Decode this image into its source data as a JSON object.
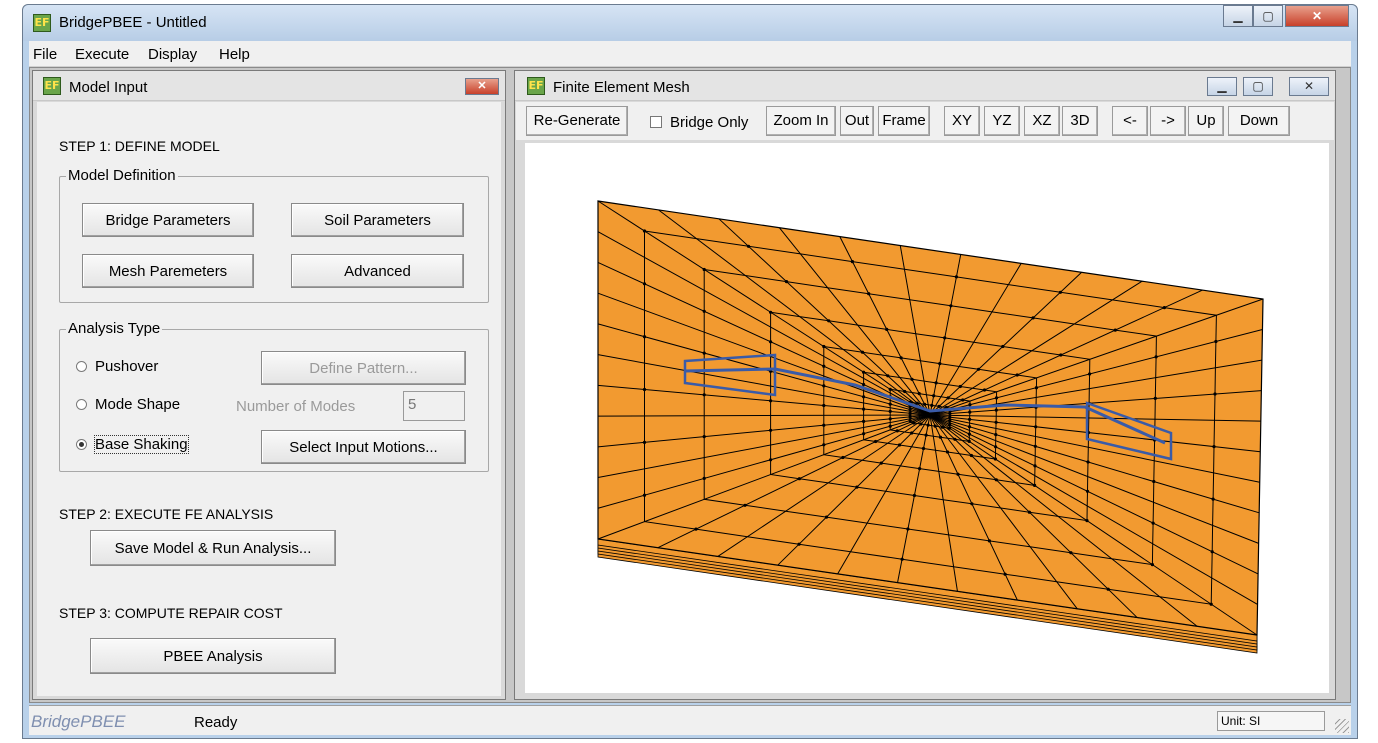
{
  "app": {
    "title": "BridgePBEE - Untitled",
    "icon": "bridgepbee-app-icon",
    "window_buttons": [
      "minimize-icon",
      "maximize-icon",
      "close-icon"
    ]
  },
  "menu": {
    "items": [
      "File",
      "Execute",
      "Display",
      "Help"
    ]
  },
  "model_input": {
    "title": "Model Input",
    "step1": "STEP 1: DEFINE MODEL",
    "model_definition": {
      "legend": "Model Definition",
      "bridge_parameters": "Bridge Parameters",
      "soil_parameters": "Soil Parameters",
      "mesh_parameters": "Mesh Paremeters",
      "advanced": "Advanced"
    },
    "analysis_type": {
      "legend": "Analysis Type",
      "pushover": "Pushover",
      "mode_shape": "Mode Shape",
      "base_shaking": "Base Shaking",
      "selected": "Base Shaking",
      "define_pattern": "Define Pattern...",
      "number_of_modes_label": "Number of Modes",
      "number_of_modes_value": "5",
      "select_input_motions": "Select Input Motions..."
    },
    "step2": "STEP 2: EXECUTE FE ANALYSIS",
    "save_run": "Save Model & Run Analysis...",
    "step3": "STEP 3: COMPUTE REPAIR COST",
    "pbee_analysis": "PBEE Analysis"
  },
  "mesh_window": {
    "title": "Finite Element Mesh",
    "toolbar": {
      "regenerate": "Re-Generate",
      "bridge_only": "Bridge Only",
      "bridge_only_checked": false,
      "zoom_in": "Zoom In",
      "out": "Out",
      "frame": "Frame",
      "xy": "XY",
      "yz": "YZ",
      "xz": "XZ",
      "three_d": "3D",
      "left": "<-",
      "right": "->",
      "up": "Up",
      "down": "Down"
    },
    "mesh_colors": {
      "fill": "#f29a30",
      "lines": "#000000",
      "bridge": "#3a5ba8"
    }
  },
  "status": {
    "app_name": "BridgePBEE",
    "text": "Ready",
    "unit": "Unit: SI"
  }
}
